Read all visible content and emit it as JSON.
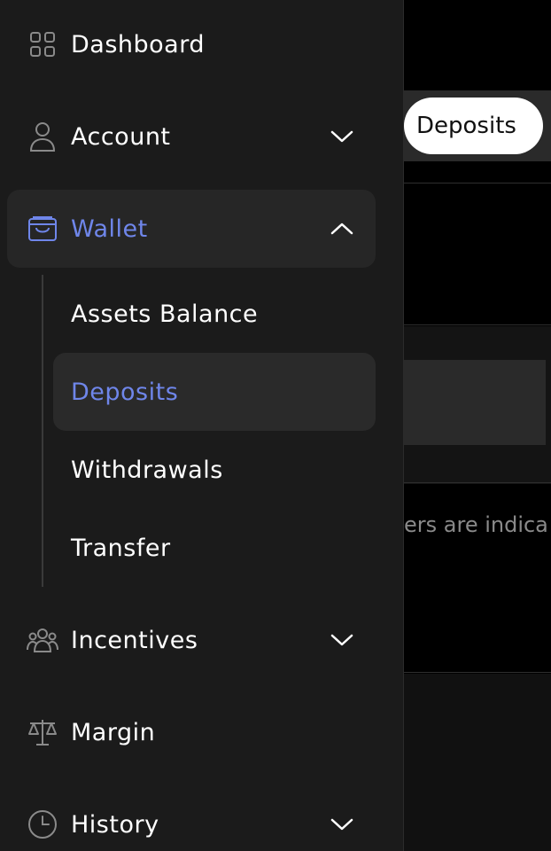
{
  "background": {
    "tab_pill_label": "Deposits",
    "partial_text": "ers are indica"
  },
  "sidebar": {
    "items": [
      {
        "label": "Dashboard"
      },
      {
        "label": "Account"
      },
      {
        "label": "Wallet"
      },
      {
        "label": "Incentives"
      },
      {
        "label": "Margin"
      },
      {
        "label": "History"
      }
    ],
    "wallet_subitems": [
      {
        "label": "Assets Balance"
      },
      {
        "label": "Deposits"
      },
      {
        "label": "Withdrawals"
      },
      {
        "label": "Transfer"
      }
    ],
    "active_color": "#6f86ea"
  }
}
